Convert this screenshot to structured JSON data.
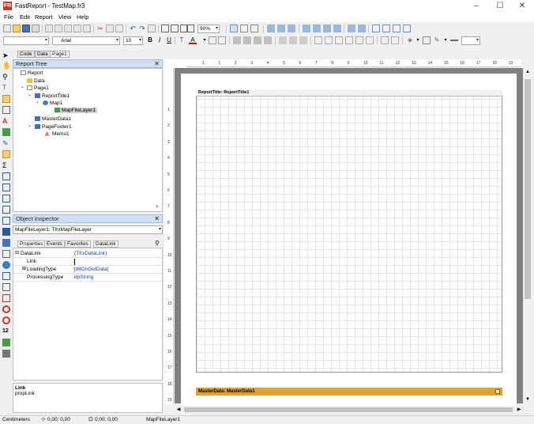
{
  "window": {
    "title": "FastReport - TestMap.fr3",
    "icon_letter": "FR"
  },
  "menu": [
    "File",
    "Edit",
    "Report",
    "View",
    "Help"
  ],
  "toolbar": {
    "zoom": "90%",
    "font_name": "Arial",
    "font_size": "10"
  },
  "doc_tabs": [
    "Code",
    "Data",
    "Page1"
  ],
  "report_tree": {
    "title": "Report Tree",
    "nodes": [
      {
        "label": "Report"
      },
      {
        "label": "Data"
      },
      {
        "label": "Page1"
      },
      {
        "label": "ReportTitle1"
      },
      {
        "label": "Map1"
      },
      {
        "label": "MapFileLayer1"
      },
      {
        "label": "MasterData1"
      },
      {
        "label": "PageFooter1"
      },
      {
        "label": "Memo1"
      }
    ]
  },
  "object_inspector": {
    "title": "Object Inspector",
    "selected": "MapFileLayer1: TfrxMapFileLayer",
    "tabs": [
      "Properties",
      "Events",
      "Favorites"
    ],
    "datalink_tab": "DataLink",
    "rows": [
      {
        "name": "DataLink",
        "value": "(TfrxDataLink)"
      },
      {
        "name": "Link",
        "value": ""
      },
      {
        "name": "LoadingType",
        "value": "[dltOnGetData]"
      },
      {
        "name": "ProcessingType",
        "value": "dpString"
      }
    ],
    "help_title": "Link",
    "help_text": "propLink"
  },
  "ruler": {
    "h": [
      "1",
      "1",
      "2",
      "3",
      "4",
      "5",
      "6",
      "7",
      "8",
      "9",
      "10",
      "11",
      "12",
      "13",
      "14",
      "15",
      "16",
      "17",
      "18",
      "19"
    ],
    "v": [
      "1",
      "2",
      "3",
      "4",
      "5",
      "6",
      "7",
      "8",
      "9",
      "10",
      "11",
      "12",
      "13",
      "14",
      "15",
      "16",
      "17",
      "18",
      "19"
    ]
  },
  "bands": {
    "report_title": "ReportTitle: ReportTitle1",
    "master_data": "MasterData: MasterData1"
  },
  "status": {
    "units": "Centimeters",
    "pos1": "0,00; 0,00",
    "pos2": "0,00; 0,00",
    "object": "MapFileLayer1"
  }
}
